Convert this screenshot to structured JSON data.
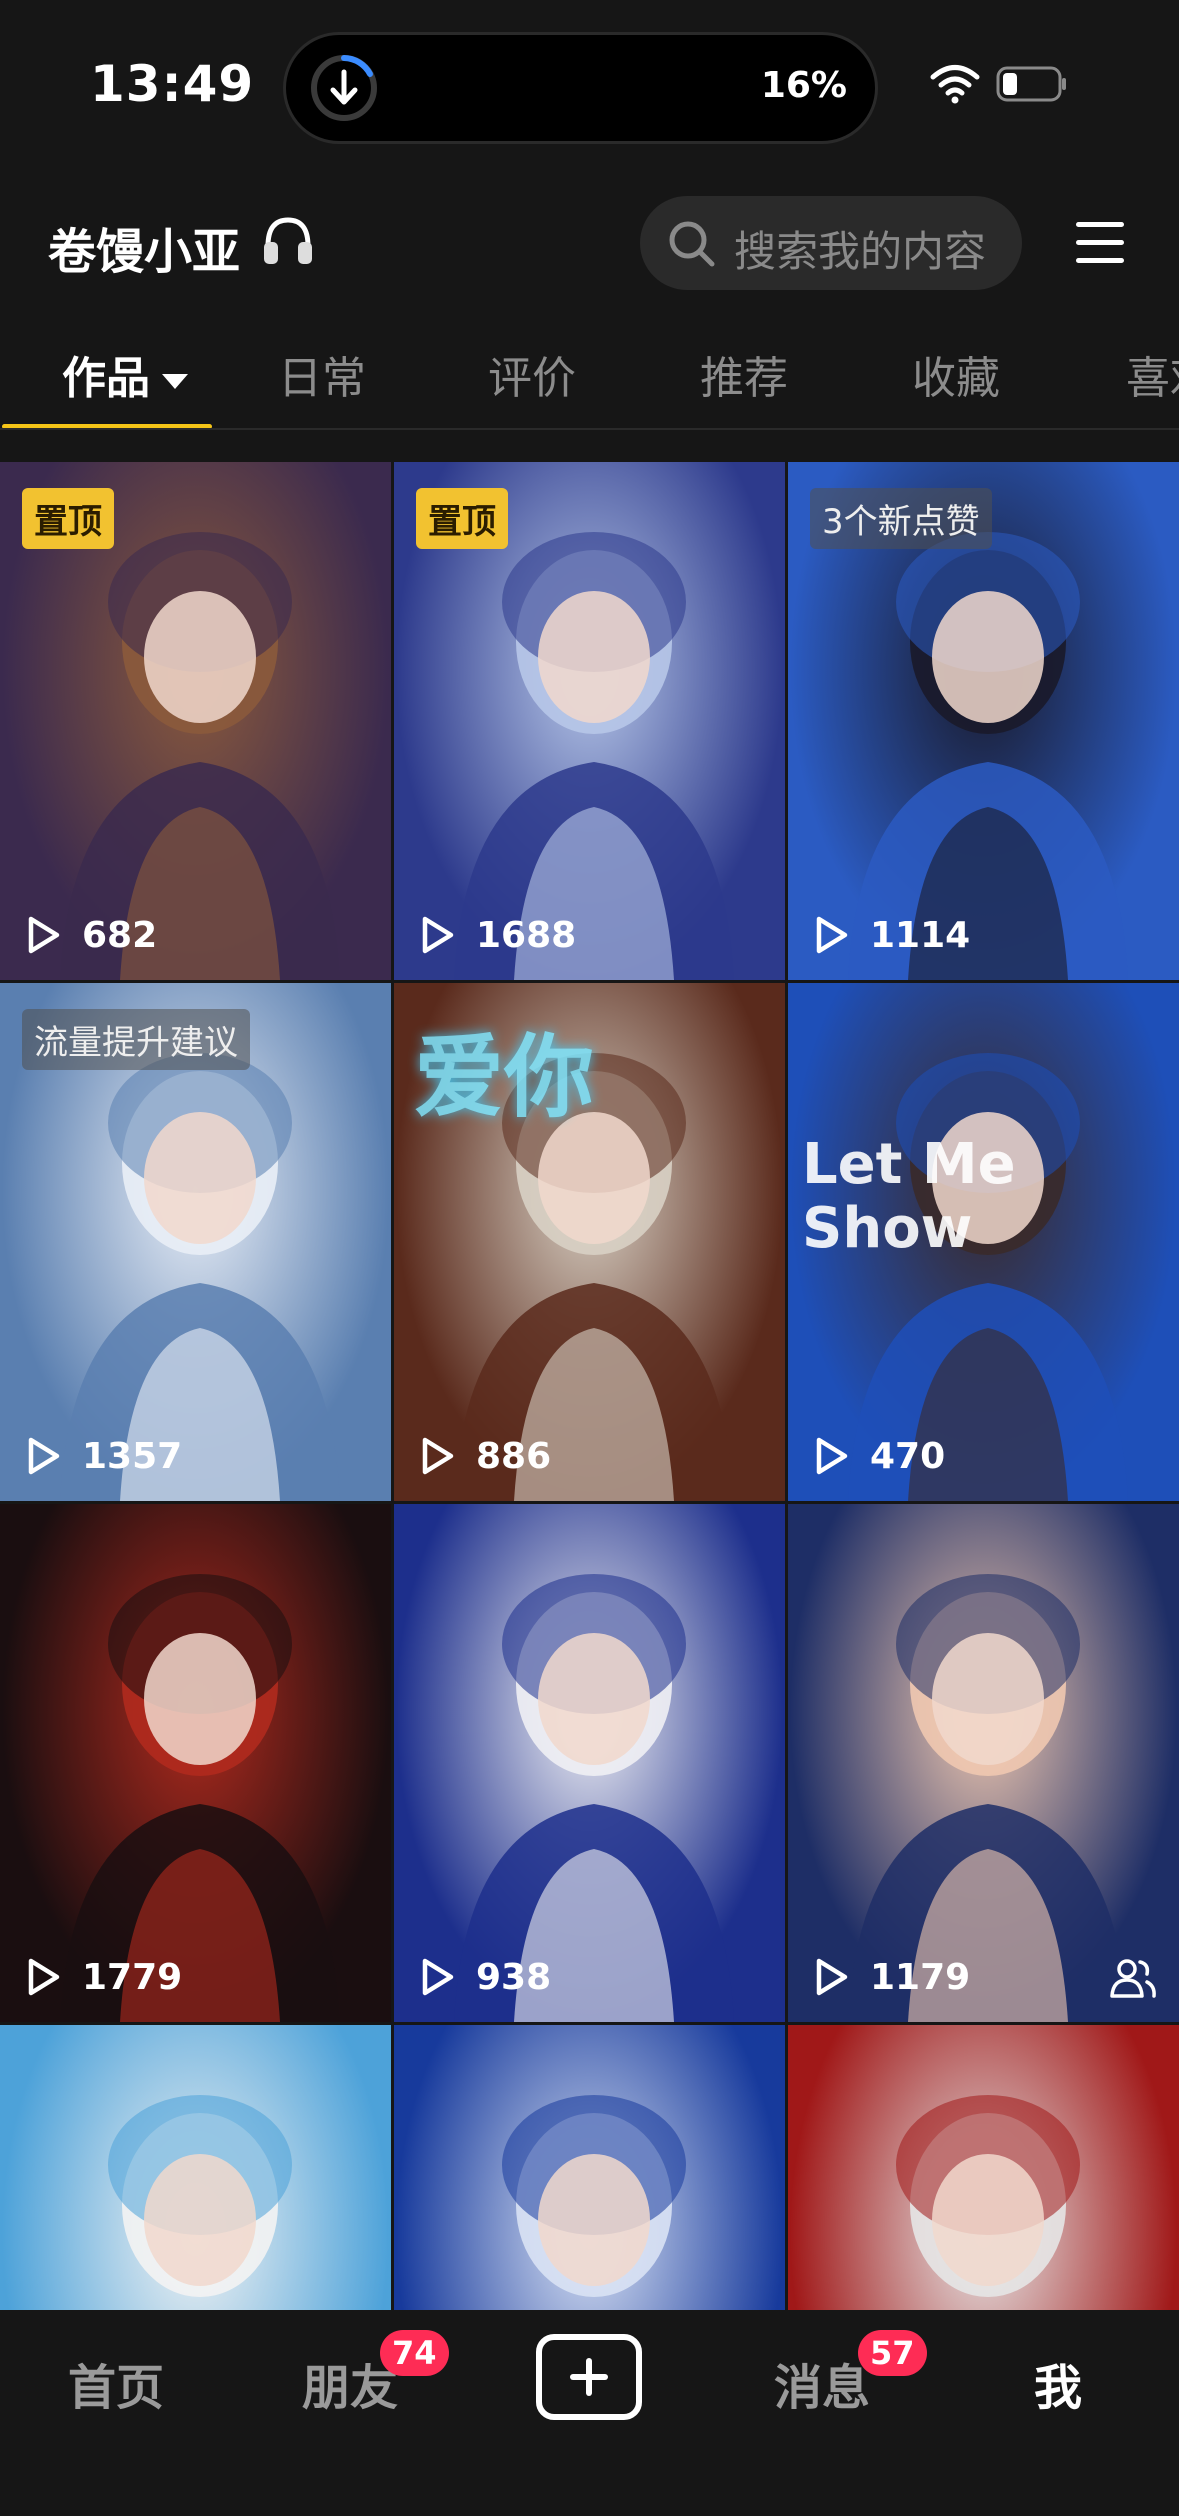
{
  "status_bar": {
    "time": "13:49",
    "battery_percent": "16%"
  },
  "header": {
    "title": "卷馒小亚",
    "search_placeholder": "搜索我的内容"
  },
  "tabs": [
    {
      "label": "作品",
      "active": true
    },
    {
      "label": "日常"
    },
    {
      "label": "评价"
    },
    {
      "label": "推荐"
    },
    {
      "label": "收藏"
    },
    {
      "label": "喜欢"
    }
  ],
  "grid": {
    "tiles": [
      {
        "badge": "置顶",
        "plays": "682",
        "palette": [
          "#3b2a4e",
          "#8b5a3c"
        ]
      },
      {
        "badge": "置顶",
        "plays": "1688",
        "palette": [
          "#2d3a8c",
          "#b7c7e8"
        ]
      },
      {
        "badge": "3个新点赞",
        "plays": "1114",
        "palette": [
          "#2b5bc2",
          "#1a1a2a"
        ]
      },
      {
        "badge": "流量提升建议",
        "plays": "1357",
        "palette": [
          "#5a7fb0",
          "#e9eef6"
        ]
      },
      {
        "plays": "886",
        "overlay": "爱你",
        "palette": [
          "#5a2a1c",
          "#d8d0c4"
        ]
      },
      {
        "plays": "470",
        "overlay": "Let Me Show",
        "palette": [
          "#1e4fb8",
          "#3a2a2a"
        ]
      },
      {
        "plays": "1779",
        "palette": [
          "#1a0e10",
          "#b02a1e"
        ]
      },
      {
        "plays": "938",
        "palette": [
          "#1d2f8c",
          "#f0f0f4"
        ]
      },
      {
        "plays": "1179",
        "palette": [
          "#1e2e66",
          "#f0c8b0"
        ],
        "shared": true
      },
      {
        "palette": [
          "#4da2d9",
          "#f3f3f3"
        ]
      },
      {
        "palette": [
          "#173a9c",
          "#d9e2f4"
        ]
      },
      {
        "palette": [
          "#a01818",
          "#e6e6e6"
        ]
      }
    ]
  },
  "bottom_nav": {
    "home": "首页",
    "friends": "朋友",
    "friends_badge": "74",
    "messages": "消息",
    "messages_badge": "57",
    "me": "我"
  }
}
